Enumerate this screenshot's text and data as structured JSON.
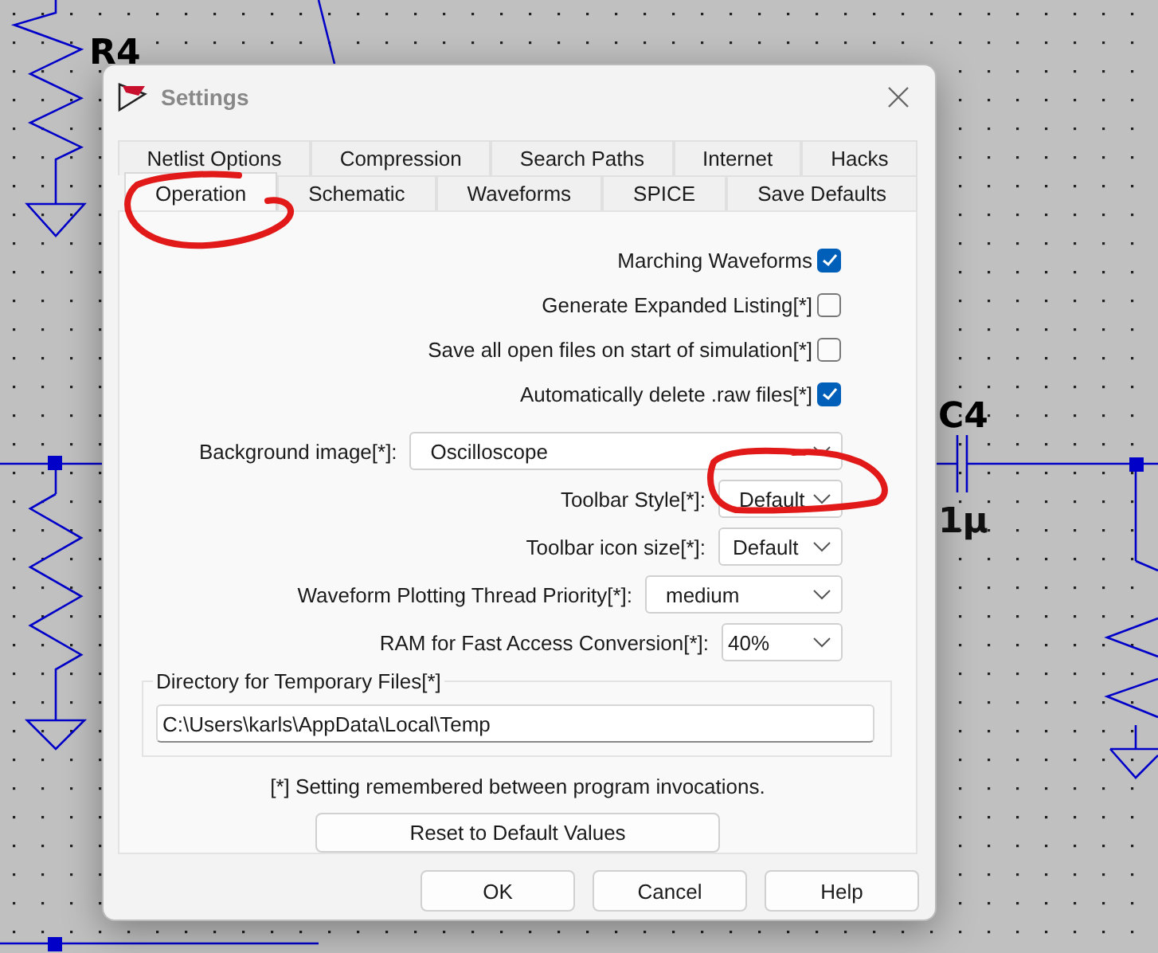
{
  "schematic": {
    "labels": [
      {
        "text": "R4",
        "kind": "name"
      },
      {
        "text": "C4",
        "kind": "name"
      },
      {
        "text": "1µ",
        "kind": "value"
      }
    ]
  },
  "dialog": {
    "title": "Settings",
    "tab_rows": [
      [
        {
          "label": "Netlist Options",
          "selected": false
        },
        {
          "label": "Compression",
          "selected": false
        },
        {
          "label": "Search Paths",
          "selected": false
        },
        {
          "label": "Internet",
          "selected": false
        },
        {
          "label": "Hacks",
          "selected": false
        }
      ],
      [
        {
          "label": "Operation",
          "selected": true
        },
        {
          "label": "Schematic",
          "selected": false
        },
        {
          "label": "Waveforms",
          "selected": false
        },
        {
          "label": "SPICE",
          "selected": false
        },
        {
          "label": "Save Defaults",
          "selected": false
        }
      ]
    ],
    "checkboxes": [
      {
        "label": "Marching Waveforms",
        "checked": true
      },
      {
        "label": "Generate Expanded Listing[*]",
        "checked": false
      },
      {
        "label": "Save all open files on start of simulation[*]",
        "checked": false
      },
      {
        "label": "Automatically delete .raw files[*]",
        "checked": true
      }
    ],
    "dropdowns": [
      {
        "label": "Background image[*]:",
        "value": "Oscilloscope"
      },
      {
        "label": "Toolbar Style[*]:",
        "value": "Default"
      },
      {
        "label": "Toolbar icon size[*]:",
        "value": "Default"
      },
      {
        "label": "Waveform Plotting Thread Priority[*]:",
        "value": "medium"
      },
      {
        "label": "RAM for Fast Access Conversion[*]:",
        "value": "40%"
      }
    ],
    "directory": {
      "label": "Directory for Temporary Files[*]",
      "value": "C:\\Users\\karls\\AppData\\Local\\Temp"
    },
    "note": "[*] Setting remembered between program invocations.",
    "reset_button": "Reset to Default Values",
    "buttons": [
      "OK",
      "Cancel",
      "Help"
    ]
  }
}
